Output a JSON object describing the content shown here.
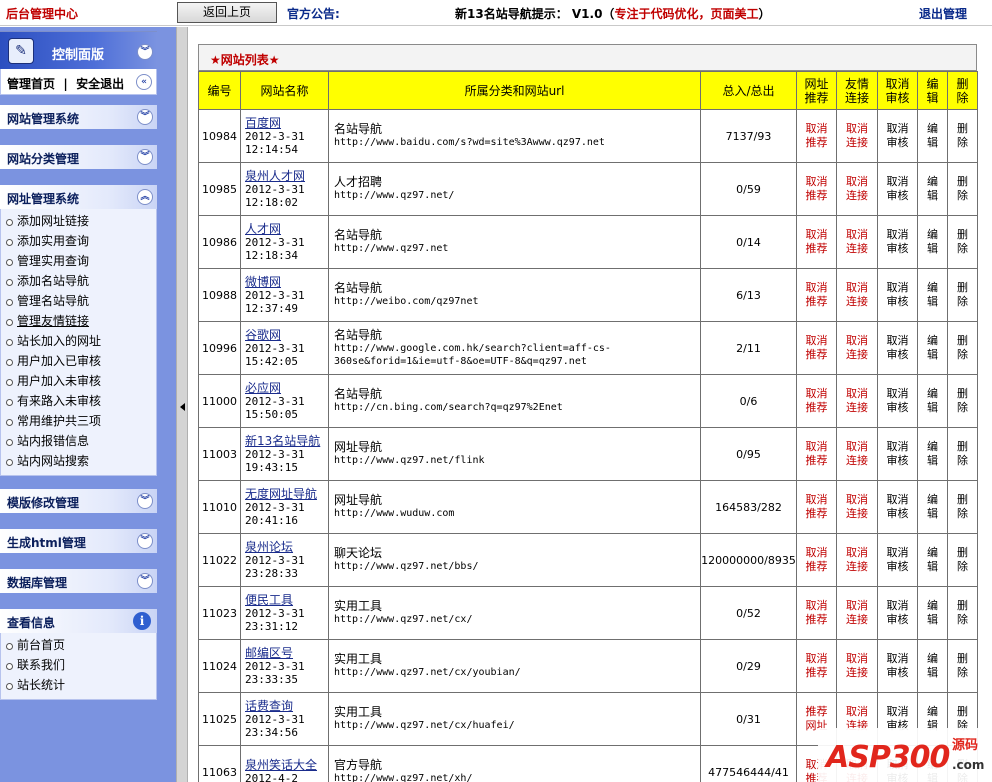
{
  "topbar": {
    "brand": "后台管理中心",
    "back_button": "返回上页",
    "notice_label": "官方公告:",
    "notice_prefix": "新13名站导航提示： V1.0（",
    "notice_highlight": "专注于代码优化，页面美工",
    "notice_suffix": "）",
    "logout": "退出管理"
  },
  "sidebar": {
    "control_panel": {
      "title": "控制面版",
      "home": "管理首页",
      "separator": "|",
      "safe_exit": "安全退出"
    },
    "panels": [
      {
        "title": "网站管理系统"
      },
      {
        "title": "网站分类管理"
      },
      {
        "title": "网址管理系统",
        "items": [
          "添加网址链接",
          "添加实用查询",
          "管理实用查询",
          "添加名站导航",
          "管理名站导航",
          "管理友情链接",
          "站长加入的网址",
          "用户加入已审核",
          "用户加入未审核",
          "有来路入未审核",
          "常用维护共三项",
          "站内报错信息",
          "站内网站搜索"
        ]
      },
      {
        "title": "模版修改管理"
      },
      {
        "title": "生成html管理"
      },
      {
        "title": "数据库管理"
      },
      {
        "title": "查看信息",
        "items": [
          "前台首页",
          "联系我们",
          "站长统计"
        ]
      }
    ]
  },
  "main": {
    "list_title": "★网站列表★",
    "headers": [
      "编号",
      "网站名称",
      "所属分类和网站url",
      "总入/总出",
      "网址推荐",
      "友情连接",
      "取消审核",
      "编辑",
      "删除"
    ],
    "rows": [
      {
        "id": "10984",
        "name": "百度网",
        "date": "2012-3-31 12:14:54",
        "category": "名站导航",
        "url": "http://www.baidu.com/s?wd=site%3Awww.qz97.net",
        "count": "7137/93",
        "rec": "取消推荐",
        "link": "取消连接",
        "audit": "取消审核",
        "edit": "编辑",
        "del": "删除"
      },
      {
        "id": "10985",
        "name": "泉州人才网",
        "date": "2012-3-31 12:18:02",
        "category": "人才招聘",
        "url": "http://www.qz97.net/",
        "count": "0/59",
        "rec": "取消推荐",
        "link": "取消连接",
        "audit": "取消审核",
        "edit": "编辑",
        "del": "删除"
      },
      {
        "id": "10986",
        "name": "人才网",
        "date": "2012-3-31 12:18:34",
        "category": "名站导航",
        "url": "http://www.qz97.net",
        "count": "0/14",
        "rec": "取消推荐",
        "link": "取消连接",
        "audit": "取消审核",
        "edit": "编辑",
        "del": "删除"
      },
      {
        "id": "10988",
        "name": "微博网",
        "date": "2012-3-31 12:37:49",
        "category": "名站导航",
        "url": "http://weibo.com/qz97net",
        "count": "6/13",
        "rec": "取消推荐",
        "link": "取消连接",
        "audit": "取消审核",
        "edit": "编辑",
        "del": "删除"
      },
      {
        "id": "10996",
        "name": "谷歌网",
        "date": "2012-3-31 15:42:05",
        "category": "名站导航",
        "url": "http://www.google.com.hk/search?client=aff-cs-360se&forid=1&ie=utf-8&oe=UTF-8&q=qz97.net",
        "count": "2/11",
        "rec": "取消推荐",
        "link": "取消连接",
        "audit": "取消审核",
        "edit": "编辑",
        "del": "删除"
      },
      {
        "id": "11000",
        "name": "必应网",
        "date": "2012-3-31 15:50:05",
        "category": "名站导航",
        "url": "http://cn.bing.com/search?q=qz97%2Enet",
        "count": "0/6",
        "rec": "取消推荐",
        "link": "取消连接",
        "audit": "取消审核",
        "edit": "编辑",
        "del": "删除"
      },
      {
        "id": "11003",
        "name": "新13名站导航",
        "date": "2012-3-31 19:43:15",
        "category": "网址导航",
        "url": "http://www.qz97.net/flink",
        "count": "0/95",
        "rec": "取消推荐",
        "link": "取消连接",
        "audit": "取消审核",
        "edit": "编辑",
        "del": "删除"
      },
      {
        "id": "11010",
        "name": "无度网址导航",
        "date": "2012-3-31 20:41:16",
        "category": "网址导航",
        "url": "http://www.wuduw.com",
        "count": "164583/282",
        "rec": "取消推荐",
        "link": "取消连接",
        "audit": "取消审核",
        "edit": "编辑",
        "del": "删除"
      },
      {
        "id": "11022",
        "name": "泉州论坛",
        "date": "2012-3-31 23:28:33",
        "category": "聊天论坛",
        "url": "http://www.qz97.net/bbs/",
        "count": "120000000/8935",
        "rec": "取消推荐",
        "link": "取消连接",
        "audit": "取消审核",
        "edit": "编辑",
        "del": "删除"
      },
      {
        "id": "11023",
        "name": "便民工具",
        "date": "2012-3-31 23:31:12",
        "category": "实用工具",
        "url": "http://www.qz97.net/cx/",
        "count": "0/52",
        "rec": "取消推荐",
        "link": "取消连接",
        "audit": "取消审核",
        "edit": "编辑",
        "del": "删除"
      },
      {
        "id": "11024",
        "name": "邮编区号",
        "date": "2012-3-31 23:33:35",
        "category": "实用工具",
        "url": "http://www.qz97.net/cx/youbian/",
        "count": "0/29",
        "rec": "取消推荐",
        "link": "取消连接",
        "audit": "取消审核",
        "edit": "编辑",
        "del": "删除"
      },
      {
        "id": "11025",
        "name": "话费查询",
        "date": "2012-3-31 23:34:56",
        "category": "实用工具",
        "url": "http://www.qz97.net/cx/huafei/",
        "count": "0/31",
        "rec": "推荐网址",
        "link": "取消连接",
        "audit": "取消审核",
        "edit": "编辑",
        "del": "删除"
      },
      {
        "id": "11063",
        "name": "泉州笑话大全",
        "date": "2012-4-2",
        "category": "官方导航",
        "url": "http://www.qz97.net/xh/",
        "count": "477546444/41",
        "rec": "取消推荐",
        "link": "取消连接",
        "audit": "取消审核",
        "edit": "编辑",
        "del": "删除"
      }
    ]
  },
  "watermark": {
    "main": "ASP300",
    "side": "源码",
    "domain": ".com"
  },
  "colors": {
    "sidebar_bg": "#7b93e0",
    "header_yellow": "#ffff00",
    "action_red": "#c00000",
    "link_blue": "#1a2c8c"
  }
}
